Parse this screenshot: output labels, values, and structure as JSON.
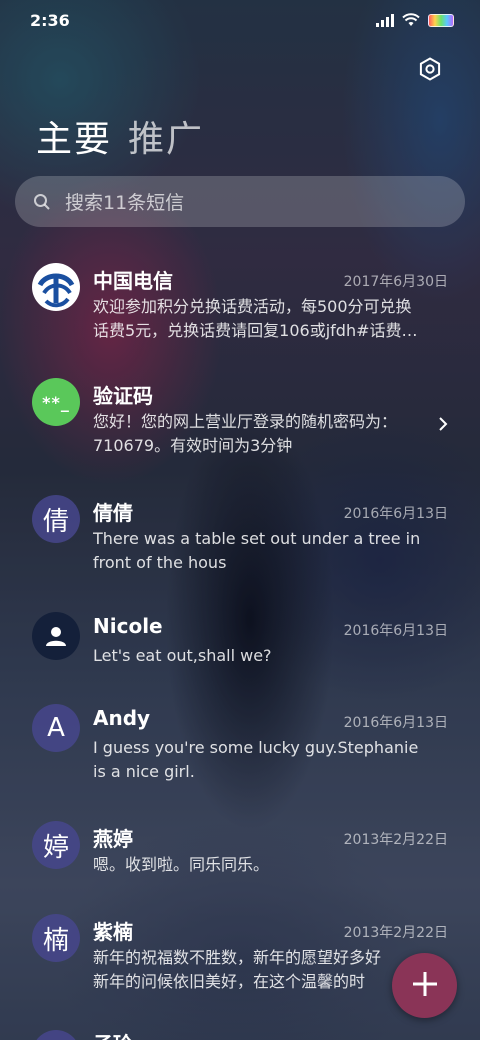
{
  "status_bar": {
    "time": "2:36",
    "icons": [
      "signal-icon",
      "wifi-icon",
      "battery-icon"
    ]
  },
  "header": {
    "settings_icon": "gear-icon",
    "tabs": [
      {
        "label": "主要"
      },
      {
        "label": "推广"
      }
    ]
  },
  "search": {
    "placeholder": "搜索11条短信",
    "icon": "search-icon"
  },
  "threads": [
    {
      "name": "中国电信",
      "date": "2017年6月30日",
      "snippet": "欢迎参加积分兑换话费活动，每500分可兑换\n话费5元，兑换话费请回复106或jfdh#话费…",
      "avatar": "china-telecom-logo"
    },
    {
      "name": "验证码",
      "date": "",
      "snippet": "您好！您的网上营业厅登录的随机密码为：\n710679。有效时间为3分钟",
      "avatar_text": "**_"
    },
    {
      "name": "倩倩",
      "date": "2016年6月13日",
      "snippet": "There was a table set out under a tree in\nfront of the hous",
      "avatar_text": "倩"
    },
    {
      "name": "Nicole",
      "date": "2016年6月13日",
      "snippet": "Let's eat out,shall we?",
      "avatar": "person-icon"
    },
    {
      "name": "Andy",
      "date": "2016年6月13日",
      "snippet": "I guess you're some lucky guy.Stephanie\nis a nice girl.",
      "avatar_text": "A"
    },
    {
      "name": "燕婷",
      "date": "2013年2月22日",
      "snippet": "嗯。收到啦。同乐同乐。",
      "avatar_text": "婷"
    },
    {
      "name": "紫楠",
      "date": "2013年2月22日",
      "snippet": "新年的祝福数不胜数，新年的愿望好多好\n新年的问候依旧美好，在这个温馨的时",
      "avatar_text": "楠"
    },
    {
      "name": "子玲",
      "date": "",
      "snippet": "",
      "avatar_text": ""
    }
  ],
  "fab": {
    "icon": "plus-icon"
  },
  "colors": {
    "fab": "#8a3457",
    "avatar": "#46468c",
    "verify": "#5ac85a",
    "telecom": "#1a4fa0"
  }
}
